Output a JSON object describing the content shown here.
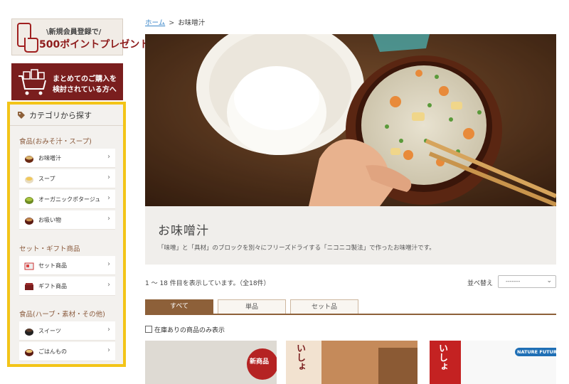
{
  "banners": {
    "register_line1": "\\新規会員登録で/",
    "register_line2": "500ポイントプレゼント",
    "bulk_line1": "まとめてのご購入を",
    "bulk_line2": "検討されている方へ"
  },
  "category": {
    "title": "カテゴリから探す",
    "groups": [
      {
        "label": "食品(おみそ汁・スープ)",
        "items": [
          {
            "label": "お味噌汁"
          },
          {
            "label": "スープ"
          },
          {
            "label": "オーガニックポタージュ"
          },
          {
            "label": "お吸い物"
          }
        ]
      },
      {
        "label": "セット・ギフト商品",
        "items": [
          {
            "label": "セット商品"
          },
          {
            "label": "ギフト商品"
          }
        ]
      },
      {
        "label": "食品(ハーブ・素材・その他)",
        "items": [
          {
            "label": "スイーツ"
          },
          {
            "label": "ごはんもの"
          }
        ]
      }
    ]
  },
  "breadcrumb": {
    "home": "ホーム",
    "separator": ">",
    "current": "お味噌汁"
  },
  "page": {
    "title": "お味噌汁",
    "description": "「味噌」と「具材」のブロックを別々にフリーズドライする「ニコニコ製法」で作ったお味噌汁です。"
  },
  "listing": {
    "count_text": "1 〜 18 件目を表示しています。（全18件）",
    "sort_label": "並べ替え",
    "sort_value": "-------",
    "stock_filter_label": "在庫ありの商品のみ表示"
  },
  "tabs": [
    {
      "label": "すべて"
    },
    {
      "label": "単品"
    },
    {
      "label": "セット品"
    }
  ],
  "cards": [
    {
      "badge": "新商品"
    },
    {
      "tag": "いしょ"
    },
    {
      "tag": "いしょ",
      "brand": "NATURE FUTURE"
    }
  ],
  "colors": {
    "accent": "#8d6039",
    "highlight": "#f3c418",
    "link": "#3a86c8",
    "banner_red": "#7a1e1e"
  }
}
